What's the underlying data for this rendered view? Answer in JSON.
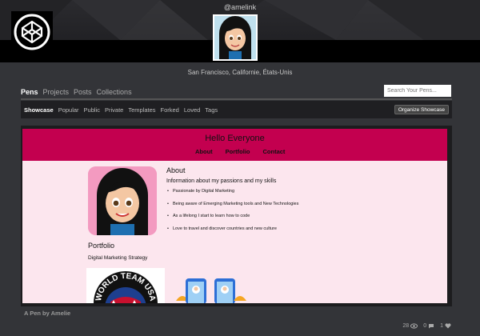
{
  "profile": {
    "handle": "@amelink",
    "location": "San Francisco, Californie, États-Unis"
  },
  "tabs": [
    {
      "label": "Pens",
      "active": true
    },
    {
      "label": "Projects",
      "active": false
    },
    {
      "label": "Posts",
      "active": false
    },
    {
      "label": "Collections",
      "active": false
    }
  ],
  "search": {
    "placeholder": "Search Your Pens..."
  },
  "subtabs": [
    {
      "label": "Showcase",
      "active": true
    },
    {
      "label": "Popular"
    },
    {
      "label": "Public"
    },
    {
      "label": "Private"
    },
    {
      "label": "Templates"
    },
    {
      "label": "Forked"
    },
    {
      "label": "Loved"
    },
    {
      "label": "Tags"
    }
  ],
  "organize_button": "Organize Showcase",
  "preview": {
    "title": "Hello Everyone",
    "nav": [
      "About",
      "Portfolio",
      "Contact"
    ],
    "about_heading": "About",
    "about_sub": "Information about my passions and my skills",
    "about_items": [
      "Passionate by Digital Marketing",
      "Being aware of Emerging Marketing tools and New Technologies",
      "As a lifelong I start to learn how to code",
      "Love to travel and discover countries and new culture"
    ],
    "portfolio_heading": "Portfolio",
    "portfolio_sub": "Digital Marketing Strategy",
    "world_team_text": "WORLD TEAM USA"
  },
  "footer": {
    "byline": "A Pen by Amelie",
    "views": "28",
    "comments": "0",
    "likes": "1"
  },
  "colors": {
    "page_bg": "#333438",
    "accent_pink": "#c3004f",
    "preview_bg": "#fce6ee"
  }
}
